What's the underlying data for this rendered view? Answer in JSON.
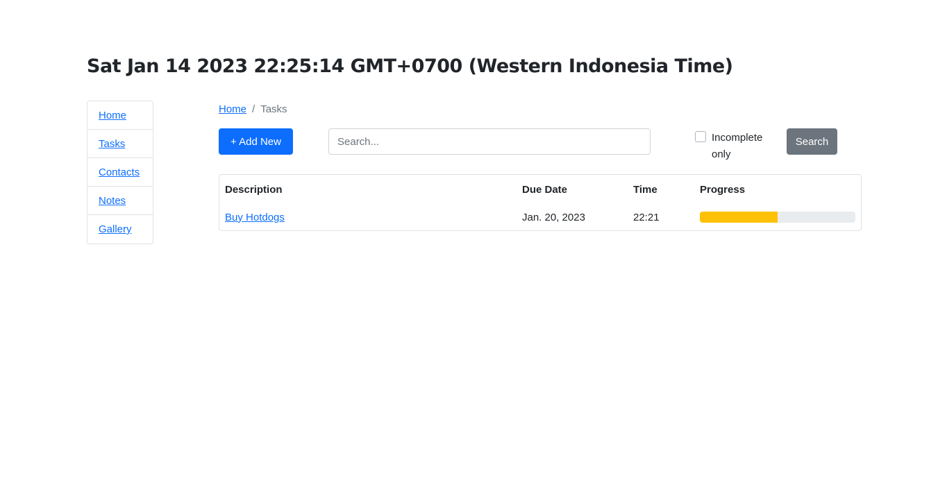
{
  "header": {
    "title": "Sat Jan 14 2023 22:25:14 GMT+0700 (Western Indonesia Time)"
  },
  "sidebar": {
    "items": [
      {
        "label": "Home"
      },
      {
        "label": "Tasks"
      },
      {
        "label": "Contacts"
      },
      {
        "label": "Notes"
      },
      {
        "label": "Gallery"
      }
    ]
  },
  "breadcrumb": {
    "home": "Home",
    "separator": "/",
    "current": "Tasks"
  },
  "toolbar": {
    "add_label": "+ Add New",
    "search_placeholder": "Search...",
    "search_value": "",
    "incomplete_label": "Incomplete only",
    "incomplete_checked": false,
    "search_button": "Search"
  },
  "table": {
    "headers": [
      "Description",
      "Due Date",
      "Time",
      "Progress"
    ],
    "rows": [
      {
        "description": "Buy Hotdogs",
        "due_date": "Jan. 20, 2023",
        "time": "22:21",
        "progress_percent": 50
      }
    ]
  },
  "colors": {
    "primary": "#0d6efd",
    "secondary": "#6c757d",
    "progress": "#ffc107"
  }
}
